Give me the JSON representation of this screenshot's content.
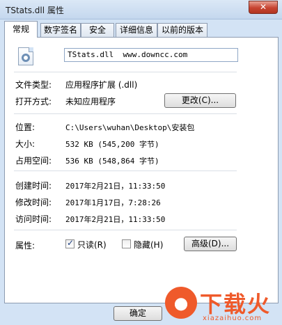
{
  "window": {
    "title": "TStats.dll 属性",
    "close_glyph": "✕"
  },
  "tabs": [
    {
      "label": "常规",
      "active": true
    },
    {
      "label": "数字签名",
      "active": false
    },
    {
      "label": "安全",
      "active": false
    },
    {
      "label": "详细信息",
      "active": false
    },
    {
      "label": "以前的版本",
      "active": false
    }
  ],
  "file": {
    "icon": "dll-file-icon",
    "name": "TStats.dll  www.downcc.com"
  },
  "fields": {
    "type_label": "文件类型:",
    "type_value": "应用程序扩展 (.dll)",
    "open_label": "打开方式:",
    "open_value": "未知应用程序",
    "change_button": "更改(C)...",
    "location_label": "位置:",
    "location_value": "C:\\Users\\wuhan\\Desktop\\安装包",
    "size_label": "大小:",
    "size_value": "532 KB (545,200 字节)",
    "disk_label": "占用空间:",
    "disk_value": "536 KB (548,864 字节)",
    "created_label": "创建时间:",
    "created_value": "2017年2月21日，11:33:50",
    "modified_label": "修改时间:",
    "modified_value": "2017年1月17日，7:28:26",
    "accessed_label": "访问时间:",
    "accessed_value": "2017年2月21日，11:33:50"
  },
  "attributes": {
    "label": "属性:",
    "readonly_label": "只读(R)",
    "readonly_checked": true,
    "check_glyph": "✓",
    "hidden_label": "隐藏(H)",
    "hidden_checked": false,
    "advanced_button": "高级(D)..."
  },
  "footer": {
    "ok_button": "确定"
  },
  "watermark": {
    "text": "下载火",
    "sub": "xiazaihuo.com",
    "color": "#ef5a2b"
  }
}
